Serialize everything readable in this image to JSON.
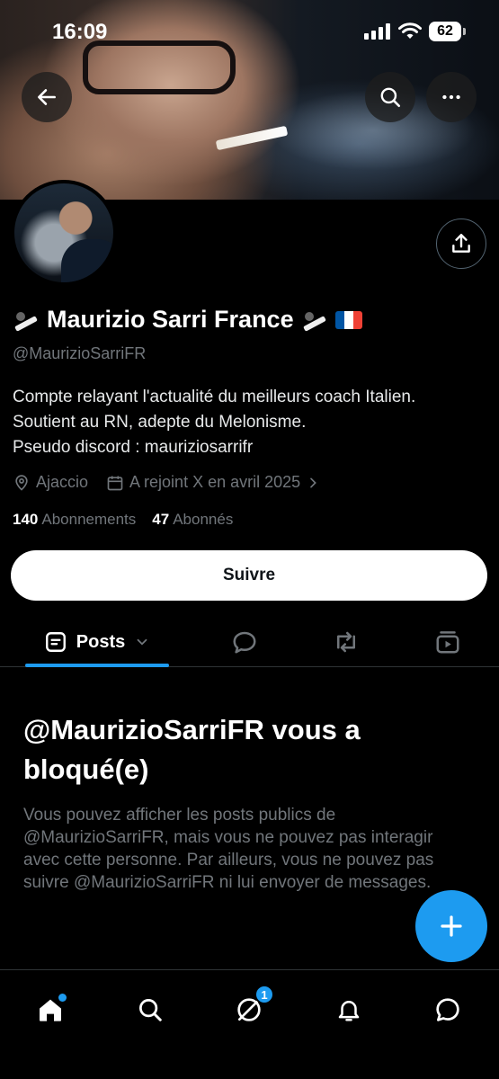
{
  "status_bar": {
    "time": "16:09",
    "battery": "62"
  },
  "profile": {
    "display_name": "Maurizio Sarri France",
    "handle": "@MaurizioSarriFR",
    "bio_lines": [
      "Compte relayant l'actualité du meilleurs coach Italien.",
      "Soutient au RN, adepte du Melonisme.",
      "Pseudo discord : mauriziosarrifr"
    ],
    "location": "Ajaccio",
    "joined": "A rejoint X en avril 2025",
    "following_count": "140",
    "following_label": "Abonnements",
    "followers_count": "47",
    "followers_label": "Abonnés",
    "follow_button": "Suivre"
  },
  "tabs": {
    "posts_label": "Posts"
  },
  "blocked": {
    "title": "@MaurizioSarriFR vous a bloqué(e)",
    "message": "Vous pouvez afficher les posts publics de @MaurizioSarriFR, mais vous ne pouvez pas interagir avec cette personne. Par ailleurs, vous ne pouvez pas suivre @MaurizioSarriFR ni lui envoyer de messages."
  },
  "bottom_nav": {
    "grok_badge": "1"
  },
  "colors": {
    "accent": "#1d9bf0",
    "muted": "#71767b",
    "background": "#000000"
  },
  "icons": [
    "back-arrow-icon",
    "search-icon",
    "more-icon",
    "share-icon",
    "location-icon",
    "calendar-icon",
    "chevron-right-icon",
    "posts-icon",
    "chevron-down-icon",
    "replies-icon",
    "reposts-icon",
    "media-icon",
    "plus-icon",
    "home-icon",
    "grok-icon",
    "notifications-icon",
    "messages-icon"
  ]
}
